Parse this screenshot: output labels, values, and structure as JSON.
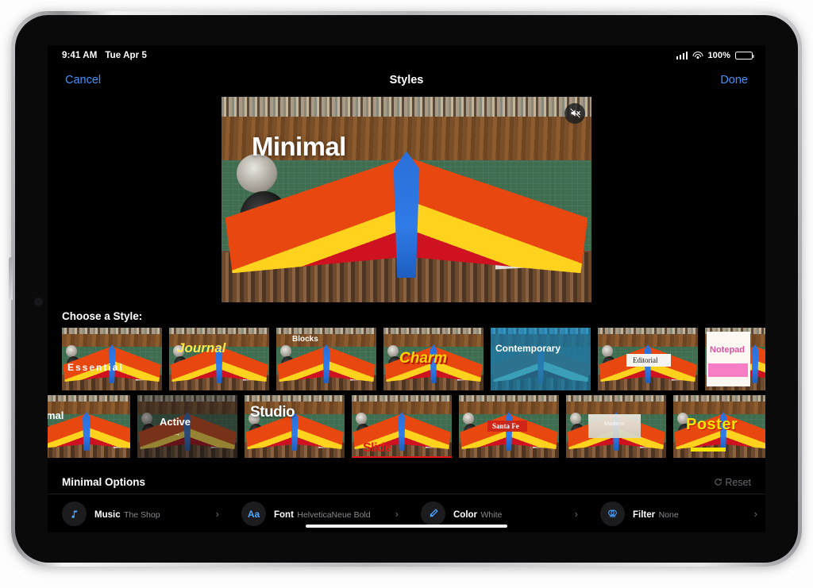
{
  "statusbar": {
    "time": "9:41 AM",
    "date": "Tue Apr 5",
    "battery_percent": "100%",
    "cellular_icon": "signal-bars-icon",
    "wifi_icon": "wifi-icon",
    "battery_icon": "battery-full-icon"
  },
  "navbar": {
    "cancel_label": "Cancel",
    "title": "Styles",
    "done_label": "Done"
  },
  "preview": {
    "overlay_title": "Minimal",
    "mute_icon": "speaker-muted-icon",
    "mute_state": "muted"
  },
  "chooser": {
    "label": "Choose a Style:",
    "rows": [
      {
        "items": [
          {
            "name": "Essential",
            "selected": false
          },
          {
            "name": "Journal",
            "selected": false
          },
          {
            "name": "Blocks",
            "selected": false
          },
          {
            "name": "Charm",
            "selected": false
          },
          {
            "name": "Contemporary",
            "selected": false
          },
          {
            "name": "Editorial",
            "selected": false
          },
          {
            "name": "Notepad",
            "selected": false
          }
        ]
      },
      {
        "items": [
          {
            "name": "Minimal",
            "selected": true
          },
          {
            "name": "Active",
            "selected": false
          },
          {
            "name": "Studio",
            "selected": false
          },
          {
            "name": "Slide",
            "selected": false
          },
          {
            "name": "Santa Fe",
            "selected": false
          },
          {
            "name": "Modern",
            "selected": false
          },
          {
            "name": "Poster",
            "selected": false
          }
        ]
      }
    ]
  },
  "options": {
    "title": "Minimal Options",
    "reset_label": "Reset",
    "reset_icon": "reset-circular-arrow-icon",
    "items": [
      {
        "name": "Music",
        "value": "The Shop",
        "icon": "music-note-icon",
        "chevron": "›"
      },
      {
        "name": "Font",
        "value": "HelveticaNeue Bold",
        "icon": "aa-text-icon",
        "chevron": "›"
      },
      {
        "name": "Color",
        "value": "White",
        "icon": "brush-icon",
        "chevron": "›"
      },
      {
        "name": "Filter",
        "value": "None",
        "icon": "filter-lens-icon",
        "chevron": "›"
      }
    ]
  },
  "colors": {
    "accent_blue": "#3f93ff",
    "icon_blue": "#4aa3ff",
    "selection_border": "#cfe4f7",
    "background": "#000000",
    "secondary_text": "#8b8b90"
  },
  "home_indicator": "home-indicator"
}
